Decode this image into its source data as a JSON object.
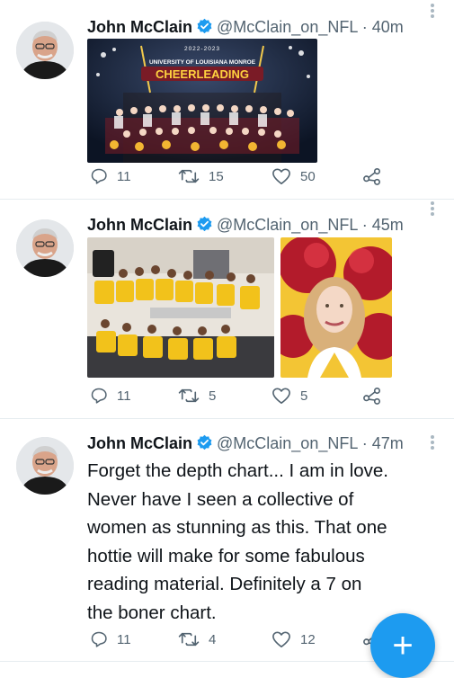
{
  "tweets": [
    {
      "name": "John McClain",
      "handle": "@McClain_on_NFL",
      "dot": " · ",
      "time": "40m",
      "media_banner_year": "2022-2023",
      "media_banner_sub": "UNIVERSITY OF LOUISIANA MONROE",
      "media_banner_title": "CHEERLEADING",
      "replies": "11",
      "retweets": "15",
      "likes": "50"
    },
    {
      "name": "John McClain",
      "handle": "@McClain_on_NFL",
      "dot": " · ",
      "time": "45m",
      "replies": "11",
      "retweets": "5",
      "likes": "5"
    },
    {
      "name": "John McClain",
      "handle": "@McClain_on_NFL",
      "dot": " · ",
      "time": "47m",
      "text_lines": [
        "Forget the depth chart... I am in love.",
        "Never have I seen a collective of",
        "women as stunning as this. That one",
        "hottie will make for some fabulous",
        "reading material. Definitely a 7 on",
        "the boner chart."
      ],
      "replies": "11",
      "retweets": "4",
      "likes": "12"
    }
  ],
  "fab": {
    "label": "+"
  },
  "icons": {
    "reply": "reply-icon",
    "retweet": "retweet-icon",
    "like": "heart-icon",
    "share": "share-icon",
    "verified": "verified-badge-icon",
    "more": "more-icon"
  },
  "colors": {
    "verified": "#1d9bf0",
    "secondary_text": "#536471",
    "fab": "#1d9bf0",
    "banner_title": "#ffd23f"
  }
}
